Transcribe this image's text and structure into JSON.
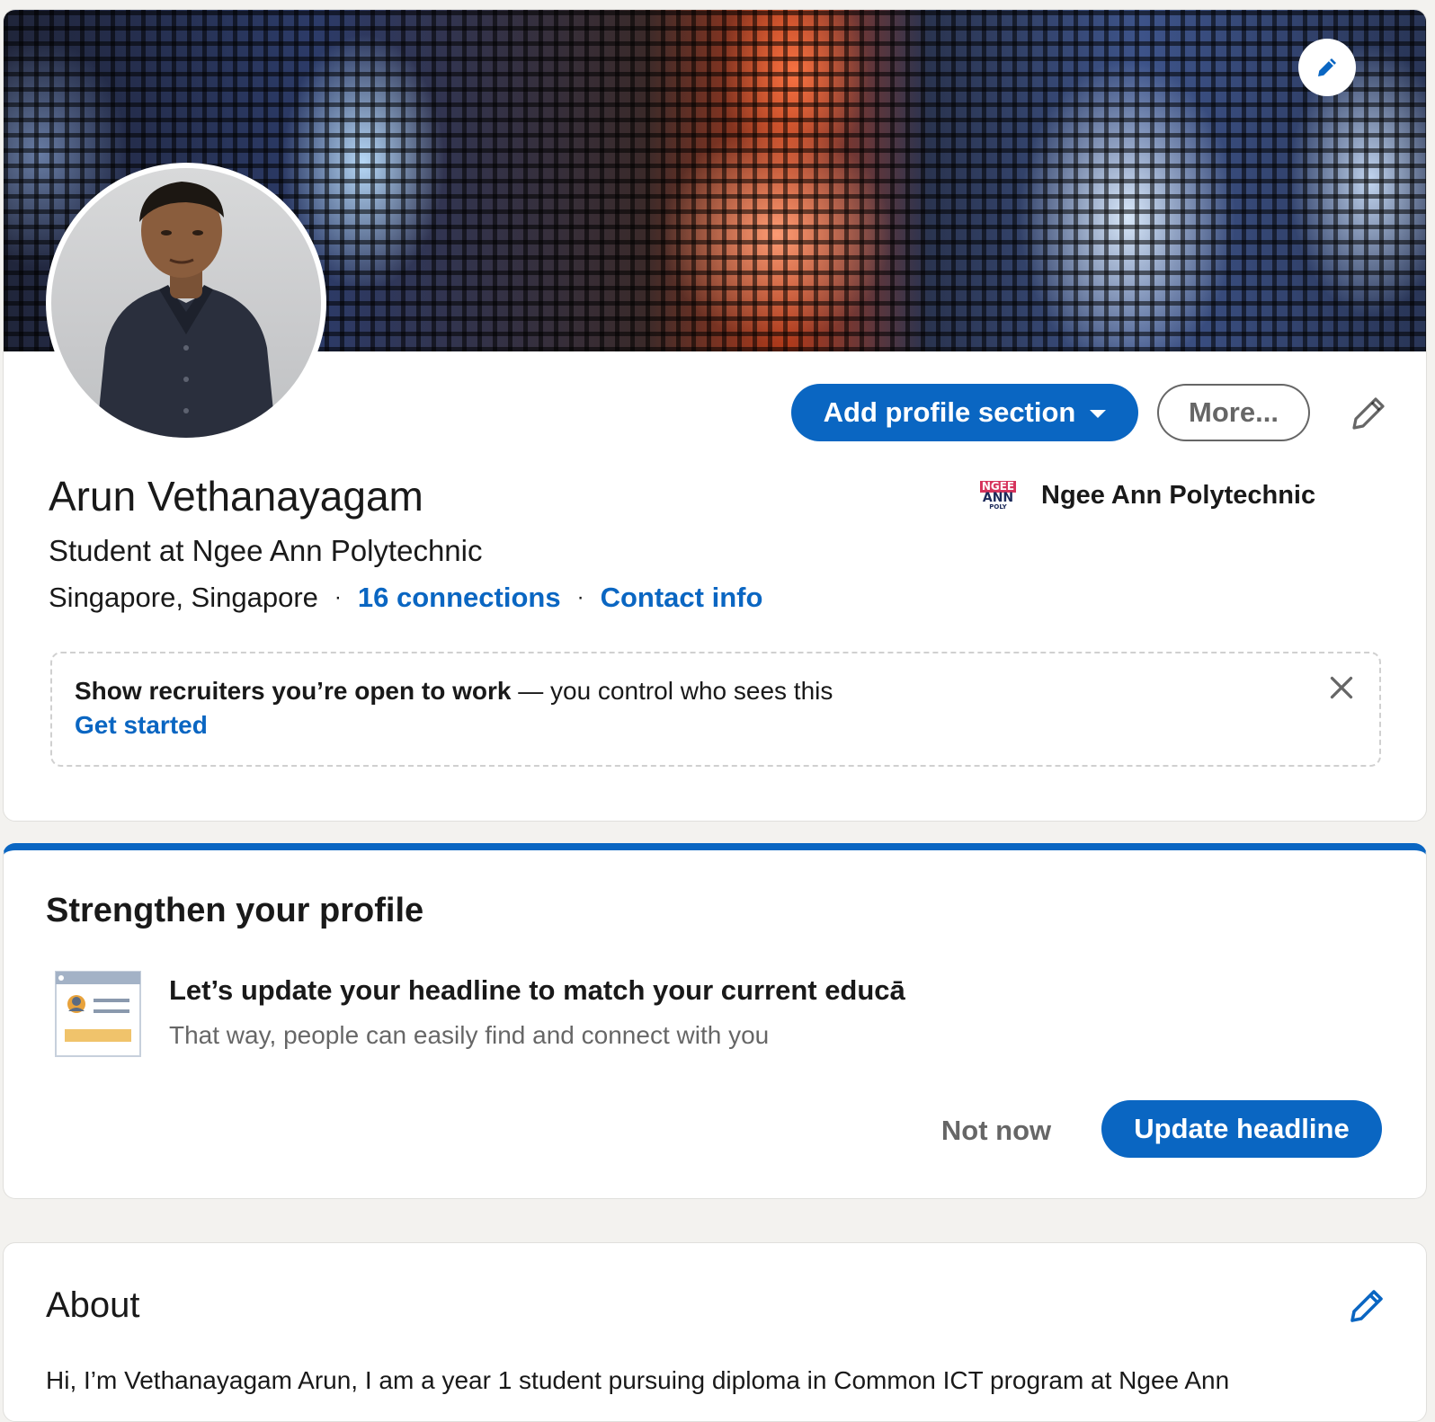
{
  "profile": {
    "name": "Arun Vethanayagam",
    "headline": "Student at Ngee Ann Polytechnic",
    "location": "Singapore, Singapore",
    "separator": "·",
    "connections_link": "16 connections",
    "contact_link": "Contact info",
    "education": {
      "name": "Ngee Ann Polytechnic",
      "logo_lines": [
        "NGEE",
        "ANN",
        "POLY"
      ]
    },
    "actions": {
      "add_section": "Add profile section",
      "more": "More..."
    }
  },
  "open_to_work": {
    "bold": "Show recruiters you’re open to work",
    "rest": " — you control who sees this",
    "cta": "Get started"
  },
  "strengthen": {
    "title": "Strengthen your profile",
    "suggestion_title": "Let’s update your headline to match your current educā",
    "suggestion_sub": "That way, people can easily find and connect with you",
    "not_now": "Not now",
    "update": "Update headline"
  },
  "about": {
    "title": "About",
    "text": "Hi, I’m Vethanayagam Arun, I am a year 1 student pursuing diploma in Common ICT program at Ngee Ann"
  },
  "icons": {
    "cover_edit": "pencil-icon",
    "intro_edit": "pencil-icon",
    "caret": "caret-down-icon",
    "close": "close-icon",
    "about_edit": "pencil-icon",
    "suggestion": "profile-card-icon"
  },
  "colors": {
    "primary": "#0a66c2",
    "page_bg": "#f3f2ef",
    "logo_red": "#d6335c",
    "logo_navy": "#1c2a5a"
  }
}
